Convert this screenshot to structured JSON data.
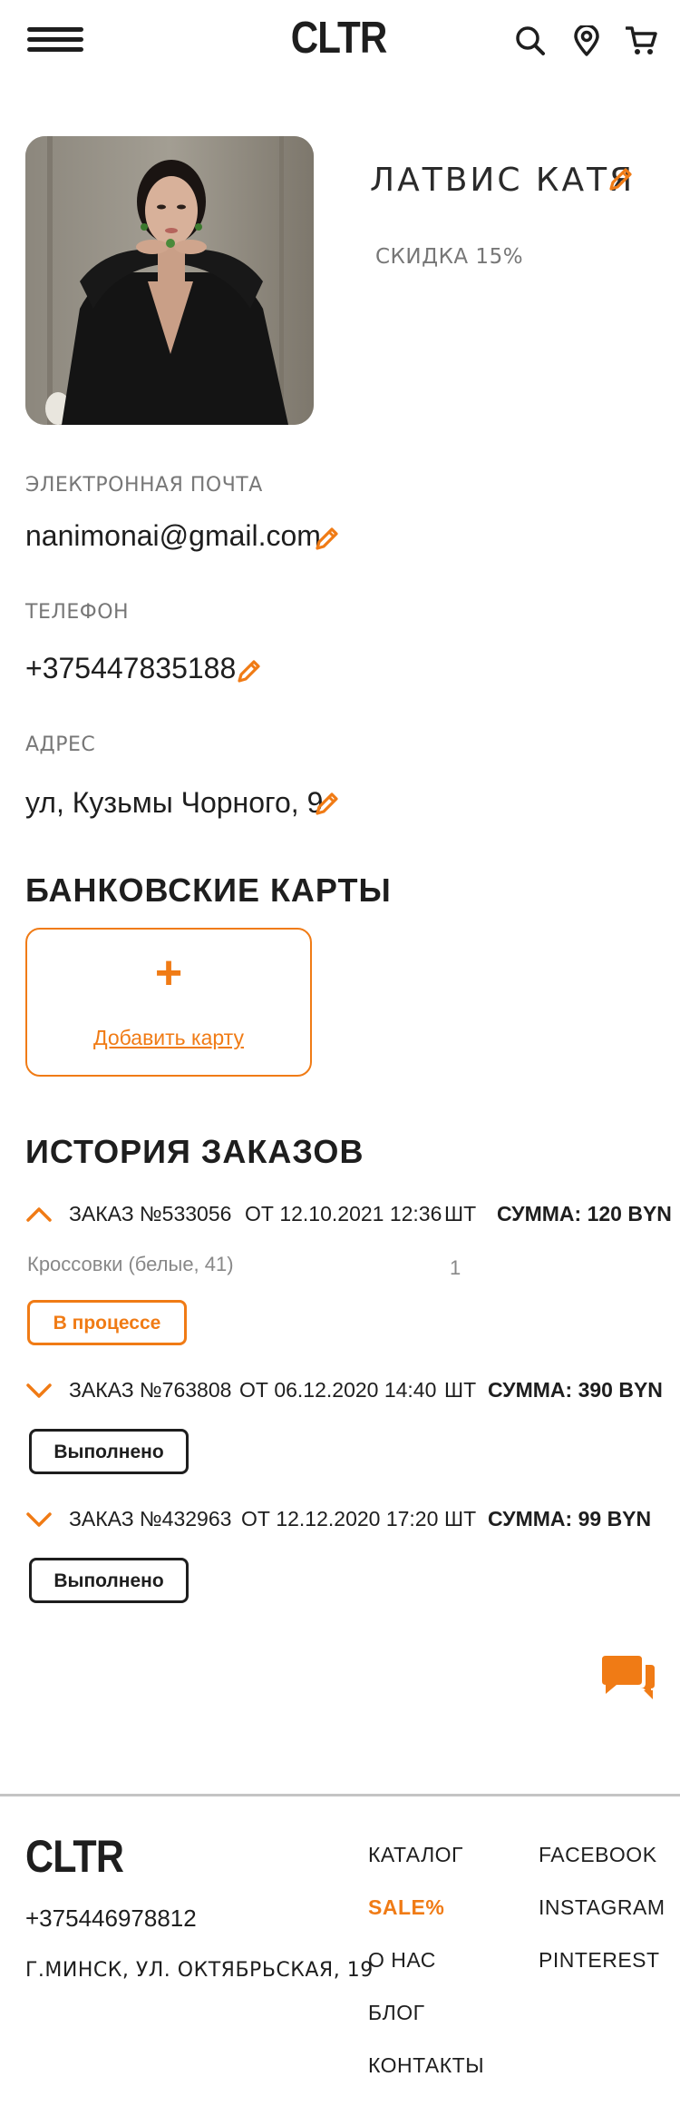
{
  "header": {
    "logo": "CLTR",
    "icons": [
      "menu-icon",
      "search-icon",
      "location-pin-icon",
      "cart-icon"
    ]
  },
  "profile": {
    "name": "ЛАТВИС КАТЯ",
    "discount": "СКИДКА 15%",
    "email_label": "ЭЛЕКТРОННАЯ ПОЧТА",
    "email": "nanimonai@gmail.com",
    "phone_label": "ТЕЛЕФОН",
    "phone": "+375447835188",
    "address_label": "АДРЕС",
    "address": "ул, Кузьмы Чорного, 9"
  },
  "cards": {
    "title": "БАНКОВСКИЕ КАРТЫ",
    "add_label": "Добавить карту"
  },
  "orders": {
    "title": "ИСТОРИЯ ЗАКАЗОВ",
    "qty_label": "ШТ",
    "list": [
      {
        "number": "ЗАКАЗ №533056",
        "date": "ОТ 12.10.2021 12:36",
        "sum": "СУММА: 120 BYN",
        "expanded": true,
        "item": "Кроссовки (белые, 41)",
        "item_qty": "1",
        "status": "В процессе"
      },
      {
        "number": "ЗАКАЗ №763808",
        "date": "ОТ 06.12.2020 14:40",
        "sum": "СУММА: 390 BYN",
        "expanded": false,
        "status": "Выполнено"
      },
      {
        "number": "ЗАКАЗ №432963",
        "date": "ОТ 12.12.2020 17:20",
        "sum": "СУММА: 99 BYN",
        "expanded": false,
        "status": "Выполнено"
      }
    ]
  },
  "footer": {
    "logo": "CLTR",
    "phone": "+375446978812",
    "address": "Г.МИНСК, УЛ. ОКТЯБРЬСКАЯ, 19",
    "nav": [
      "КАТАЛОГ",
      "SALE%",
      "О НАС",
      "БЛОГ",
      "КОНТАКТЫ"
    ],
    "social": [
      "FACEBOOK",
      "INSTAGRAM",
      "PINTEREST"
    ]
  },
  "colors": {
    "accent": "#f07b15",
    "text": "#1e1e1e",
    "muted": "#777777"
  }
}
